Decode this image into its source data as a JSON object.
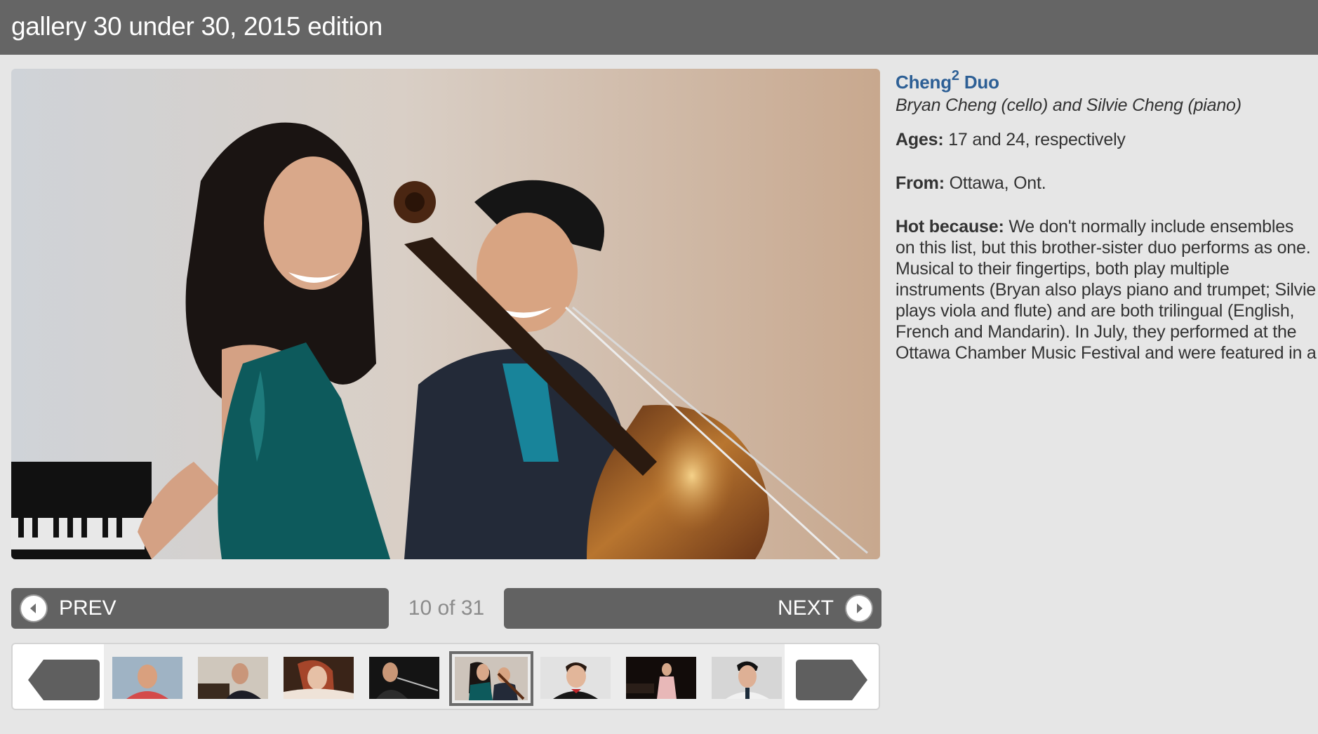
{
  "header": {
    "title": "gallery 30 under 30, 2015 edition"
  },
  "photo": {
    "alt": "Cheng2 Duo"
  },
  "caption": {
    "title_main": "Cheng",
    "title_sup": "2",
    "title_rest": " Duo",
    "subtitle": "Bryan Cheng (cello) and Silvie Cheng (piano)",
    "ages_label": "Ages:",
    "ages_value": " 17 and 24, respectively",
    "from_label": "From:",
    "from_value": " Ottawa, Ont.",
    "hot_label": "Hot because:",
    "hot_value": " We don't normally include ensembles on this list, but this brother-sister duo performs as one. Musical to their fingertips, both play multiple instruments (Bryan also plays piano and trumpet; Silvie plays viola and flute) and are both trilingual (English, French and Mandarin). In July, they performed at the Ottawa Chamber Music Festival and were featured in a studio performance"
  },
  "nav": {
    "prev_label": "PREV",
    "next_label": "NEXT",
    "counter": "10 of 31"
  },
  "thumbnails": {
    "selected_index": 4,
    "count": 8
  },
  "colors": {
    "header_bg": "#656565",
    "accent_link": "#2d5f95",
    "button_bg": "#626262"
  }
}
